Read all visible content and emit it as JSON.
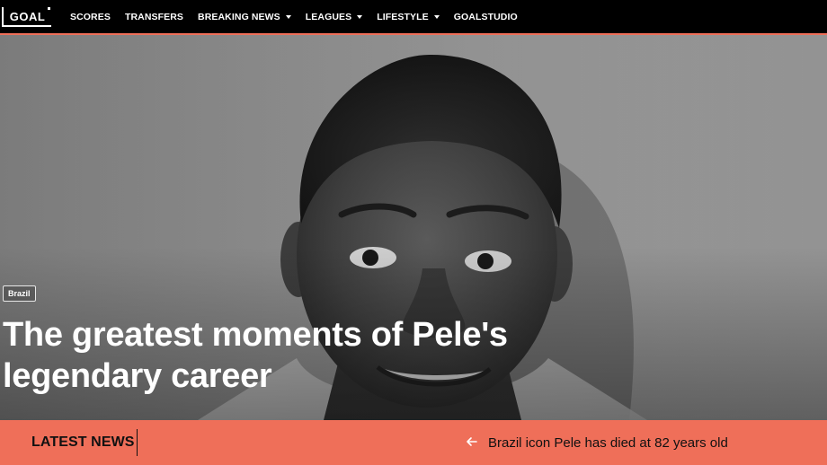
{
  "nav": {
    "logo_text": "GOAL",
    "items": [
      {
        "label": "SCORES",
        "has_dropdown": false
      },
      {
        "label": "TRANSFERS",
        "has_dropdown": false
      },
      {
        "label": "BREAKING NEWS",
        "has_dropdown": true
      },
      {
        "label": "LEAGUES",
        "has_dropdown": true
      },
      {
        "label": "LIFESTYLE",
        "has_dropdown": true
      },
      {
        "label": "GOALSTUDIO",
        "has_dropdown": false
      }
    ]
  },
  "hero": {
    "tag": "Brazil",
    "headline": "The greatest moments of Pele's legendary career",
    "image_icon": "portrait-photo"
  },
  "latest_news": {
    "label": "LATEST NEWS",
    "prev_icon": "arrow-left-icon",
    "headline": "Brazil icon Pele has died at 82 years old"
  },
  "colors": {
    "accent": "#ef6f59",
    "nav_bg": "#000000",
    "text_light": "#ffffff",
    "text_dark": "#111111"
  }
}
